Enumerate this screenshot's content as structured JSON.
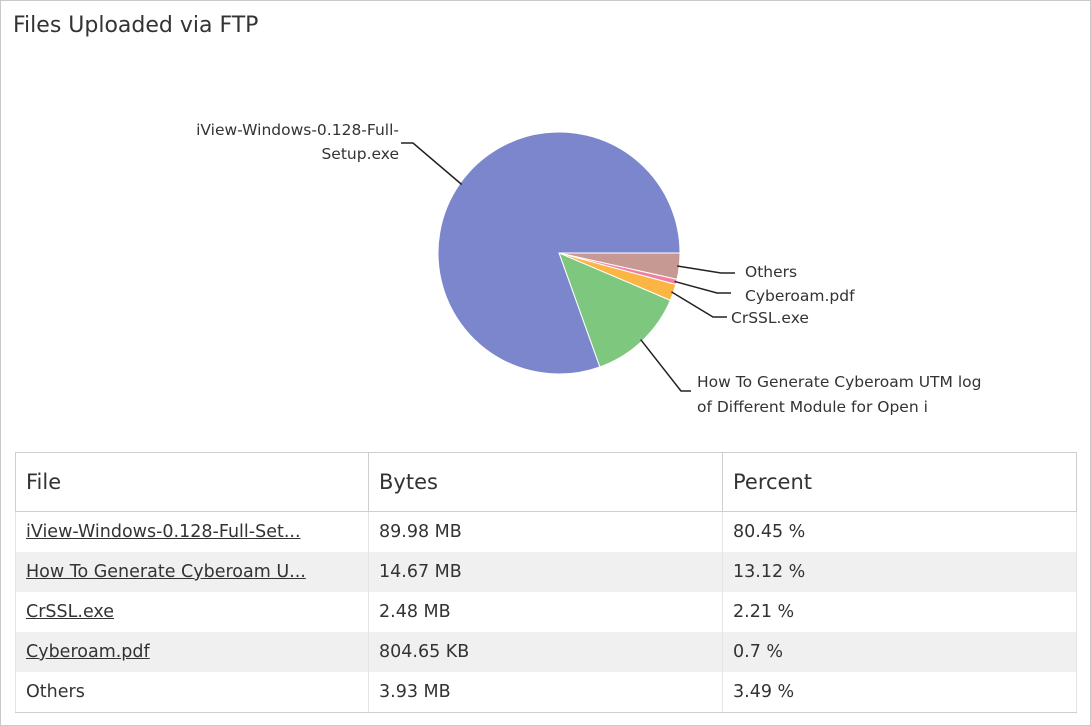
{
  "panel": {
    "title": "Files Uploaded via FTP"
  },
  "chart_data": {
    "type": "pie",
    "title": "Files Uploaded via FTP",
    "slices": [
      {
        "label_lines": [
          "iView-Windows-0.128-Full-",
          "Setup.exe"
        ],
        "label": "iView-Windows-0.128-Full-Setup.exe",
        "value": 80.45,
        "color": "#7b86cc"
      },
      {
        "label_lines": [
          "How To Generate Cyberoam UTM log",
          "of Different Module for Open i"
        ],
        "label": "How To Generate Cyberoam UTM log of Different Module for Open i",
        "value": 13.12,
        "color": "#7dc77e"
      },
      {
        "label_lines": [
          "CrSSL.exe"
        ],
        "label": "CrSSL.exe",
        "value": 2.21,
        "color": "#fbb545"
      },
      {
        "label_lines": [
          "Cyberoam.pdf"
        ],
        "label": "Cyberoam.pdf",
        "value": 0.7,
        "color": "#ef7fa3"
      },
      {
        "label_lines": [
          "Others"
        ],
        "label": "Others",
        "value": 3.49,
        "color": "#c69a93"
      }
    ]
  },
  "table": {
    "headers": {
      "file": "File",
      "bytes": "Bytes",
      "percent": "Percent"
    },
    "rows": [
      {
        "file": "iView-Windows-0.128-Full-Set...",
        "bytes": "89.98 MB",
        "percent": "80.45 %",
        "link": true
      },
      {
        "file": "How To Generate Cyberoam U...",
        "bytes": "14.67 MB",
        "percent": "13.12 %",
        "link": true
      },
      {
        "file": "CrSSL.exe",
        "bytes": "2.48 MB",
        "percent": "2.21 %",
        "link": true
      },
      {
        "file": "Cyberoam.pdf",
        "bytes": "804.65 KB",
        "percent": "0.7 %",
        "link": true
      },
      {
        "file": "Others",
        "bytes": "3.93 MB",
        "percent": "3.49 %",
        "link": false
      }
    ]
  }
}
